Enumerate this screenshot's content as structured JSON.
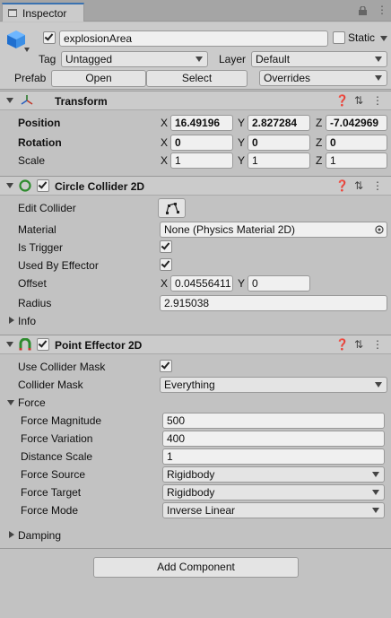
{
  "tab": {
    "label": "Inspector"
  },
  "gameobject": {
    "active": true,
    "name": "explosionArea",
    "static_label": "Static",
    "tag_label": "Tag",
    "tag_value": "Untagged",
    "layer_label": "Layer",
    "layer_value": "Default",
    "prefab_label": "Prefab",
    "open_label": "Open",
    "select_label": "Select",
    "overrides_label": "Overrides"
  },
  "transform": {
    "title": "Transform",
    "position_label": "Position",
    "rotation_label": "Rotation",
    "scale_label": "Scale",
    "axes": [
      "X",
      "Y",
      "Z"
    ],
    "position": [
      "16.49196",
      "2.827284",
      "-7.042969"
    ],
    "rotation": [
      "0",
      "0",
      "0"
    ],
    "scale": [
      "1",
      "1",
      "1"
    ]
  },
  "circle_collider": {
    "title": "Circle Collider 2D",
    "edit_collider_label": "Edit Collider",
    "material_label": "Material",
    "material_value": "None (Physics Material 2D)",
    "is_trigger_label": "Is Trigger",
    "used_by_effector_label": "Used By Effector",
    "offset_label": "Offset",
    "offset": [
      "0.04556411",
      "0"
    ],
    "offset_axes": [
      "X",
      "Y"
    ],
    "radius_label": "Radius",
    "radius_value": "2.915038",
    "info_label": "Info"
  },
  "point_effector": {
    "title": "Point Effector 2D",
    "use_collider_mask_label": "Use Collider Mask",
    "collider_mask_label": "Collider Mask",
    "collider_mask_value": "Everything",
    "force_label": "Force",
    "force_magnitude_label": "Force Magnitude",
    "force_magnitude": "500",
    "force_variation_label": "Force Variation",
    "force_variation": "400",
    "distance_scale_label": "Distance Scale",
    "distance_scale": "1",
    "force_source_label": "Force Source",
    "force_source": "Rigidbody",
    "force_target_label": "Force Target",
    "force_target": "Rigidbody",
    "force_mode_label": "Force Mode",
    "force_mode": "Inverse Linear",
    "damping_label": "Damping"
  },
  "add_component_label": "Add Component",
  "colors": {
    "accent": "#3a72b0",
    "panel": "#c2c2c2",
    "header": "#cbcbcb"
  }
}
